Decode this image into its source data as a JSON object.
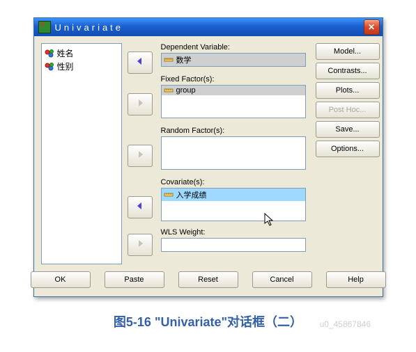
{
  "window": {
    "title": "Univariate",
    "close_glyph": "✕"
  },
  "source_list": {
    "items": [
      {
        "label": "姓名"
      },
      {
        "label": "性别"
      }
    ]
  },
  "arrows": {
    "a1_title": "move-to-dependent",
    "a2_title": "move-to-fixed",
    "a3_title": "move-to-random",
    "a4_title": "move-to-covariate",
    "a5_title": "move-to-wls"
  },
  "fields": {
    "dependent": {
      "label": "Dependent Variable:",
      "value": "数学"
    },
    "fixed": {
      "label": "Fixed Factor(s):",
      "value": "group"
    },
    "random": {
      "label": "Random Factor(s):"
    },
    "covariate": {
      "label": "Covariate(s):",
      "value": "入学成绩"
    },
    "wls": {
      "label": "WLS Weight:"
    }
  },
  "right_buttons": {
    "model": "Model...",
    "contrasts": "Contrasts...",
    "plots": "Plots...",
    "posthoc": "Post Hoc...",
    "save": "Save...",
    "options": "Options..."
  },
  "bottom": {
    "ok": "OK",
    "paste": "Paste",
    "reset": "Reset",
    "cancel": "Cancel",
    "help": "Help"
  },
  "caption": "图5-16  \"Univariate\"对话框（二）",
  "watermark": "u0_45867846"
}
